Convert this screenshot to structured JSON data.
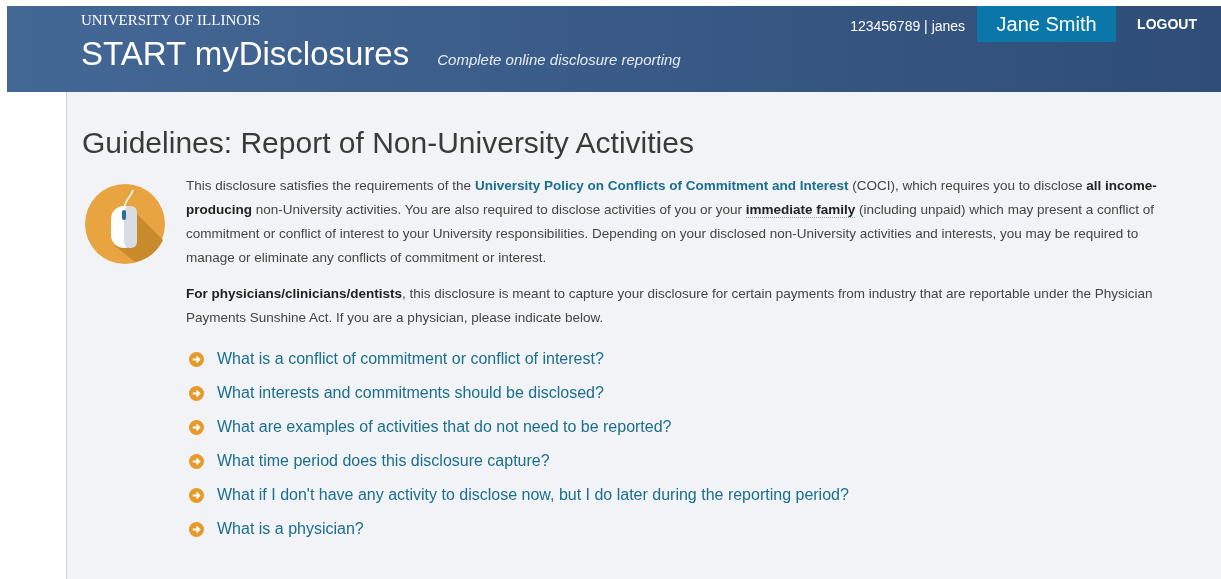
{
  "header": {
    "university": "UNIVERSITY OF ILLINOIS",
    "app_title": "START myDisclosures",
    "tagline": "Complete online disclosure reporting",
    "user_id": "123456789 | janes",
    "user_name": "Jane Smith",
    "logout": "LOGOUT"
  },
  "page_title": "Guidelines: Report of Non-University Activities",
  "intro": [
    {
      "kind": "text",
      "text": "This disclosure satisfies the requirements of the "
    },
    {
      "kind": "link",
      "text": "University Policy on Conflicts of Commitment and Interest"
    },
    {
      "kind": "text",
      "text": " (COCI), which requires you to disclose **all income-producing** non-University activities. You are also required to disclose activities of you or your "
    },
    {
      "kind": "term",
      "text": "immediate family"
    },
    {
      "kind": "text",
      "text": " (including unpaid) which may present a conflict of commitment or conflict of interest to your University responsibilities. Depending on your disclosed non-University activities and interests, you may be required to manage or eliminate any conflicts of commitment or interest."
    }
  ],
  "physician_note": "**For physicians/clinicians/dentists**, this disclosure is meant to capture your disclosure for certain payments from industry that are reportable under the Physician Payments Sunshine Act. If you are a physician, please indicate below.",
  "faq": [
    {
      "question": "What is a conflict of commitment or conflict of interest?"
    },
    {
      "question": "What interests and commitments should be disclosed?"
    },
    {
      "question": "What are examples of activities that do not need to be reported?"
    },
    {
      "question": "What time period does this disclosure capture?"
    },
    {
      "question": "What if I don't have any activity to disclose now, but I do later during the reporting period?"
    },
    {
      "question": "What is a physician?"
    }
  ]
}
